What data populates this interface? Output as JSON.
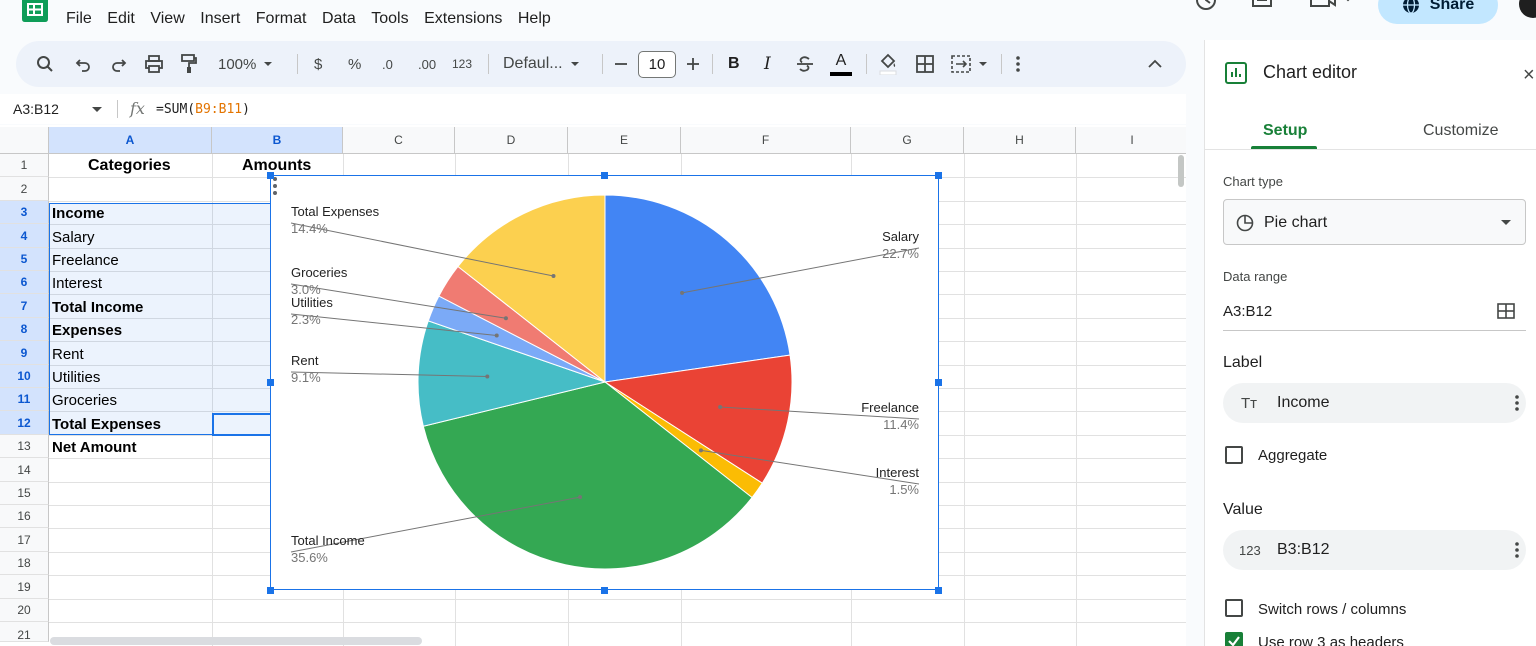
{
  "menu": [
    "File",
    "Edit",
    "View",
    "Insert",
    "Format",
    "Data",
    "Tools",
    "Extensions",
    "Help"
  ],
  "share_label": "Share",
  "toolbar": {
    "zoom": "100%",
    "currency": "$",
    "percent": "%",
    "decrease_decimals": ".0",
    "increase_decimals": ".00",
    "number_format": "123",
    "font": "Defaul...",
    "font_size": "10",
    "bold": "B",
    "italic": "I",
    "text_color": "A"
  },
  "formula_bar": {
    "name_box": "A3:B12",
    "fx": "fx",
    "formula_prefix": "=SUM(",
    "formula_ref": "B9:B11",
    "formula_suffix": ")"
  },
  "grid": {
    "columns": [
      "A",
      "B",
      "C",
      "D",
      "E",
      "F",
      "G",
      "H",
      "I"
    ],
    "rows": [
      "1",
      "2",
      "3",
      "4",
      "5",
      "6",
      "7",
      "8",
      "9",
      "10",
      "11",
      "12",
      "13",
      "14",
      "15",
      "16",
      "17",
      "18",
      "19",
      "20",
      "21"
    ],
    "header_a": "Categories",
    "header_b": "Amounts",
    "cells_a": [
      "",
      "Income",
      "Salary",
      "Freelance",
      "Interest",
      "Total Income",
      "Expenses",
      "Rent",
      "Utilities",
      "Groceries",
      "Total Expenses",
      "Net Amount"
    ]
  },
  "chart_data": {
    "type": "pie",
    "categories": [
      "Salary",
      "Freelance",
      "Interest",
      "Total Income",
      "Rent",
      "Utilities",
      "Groceries",
      "Total Expenses"
    ],
    "values": [
      22.7,
      11.4,
      1.5,
      35.6,
      9.1,
      2.3,
      3.0,
      14.4
    ],
    "value_labels": [
      "22.7%",
      "11.4%",
      "1.5%",
      "35.6%",
      "9.1%",
      "2.3%",
      "3.0%",
      "14.4%"
    ],
    "colors": [
      "#4285f4",
      "#ea4335",
      "#fbbc04",
      "#34a853",
      "#46bdc6",
      "#7baaf7",
      "#f07b72",
      "#fcd04f"
    ],
    "legend": "labeled slices"
  },
  "editor": {
    "title": "Chart editor",
    "close": "×",
    "tab_setup": "Setup",
    "tab_customize": "Customize",
    "chart_type_caption": "Chart type",
    "chart_type_value": "Pie chart",
    "data_range_caption": "Data range",
    "data_range_value": "A3:B12",
    "label_section": "Label",
    "label_chip_icon": "Tт",
    "label_chip": "Income",
    "aggregate": "Aggregate",
    "value_section": "Value",
    "value_chip_icon": "123",
    "value_chip": "B3:B12",
    "switch_rows": "Switch rows / columns",
    "use_row_headers": "Use row 3 as headers"
  }
}
